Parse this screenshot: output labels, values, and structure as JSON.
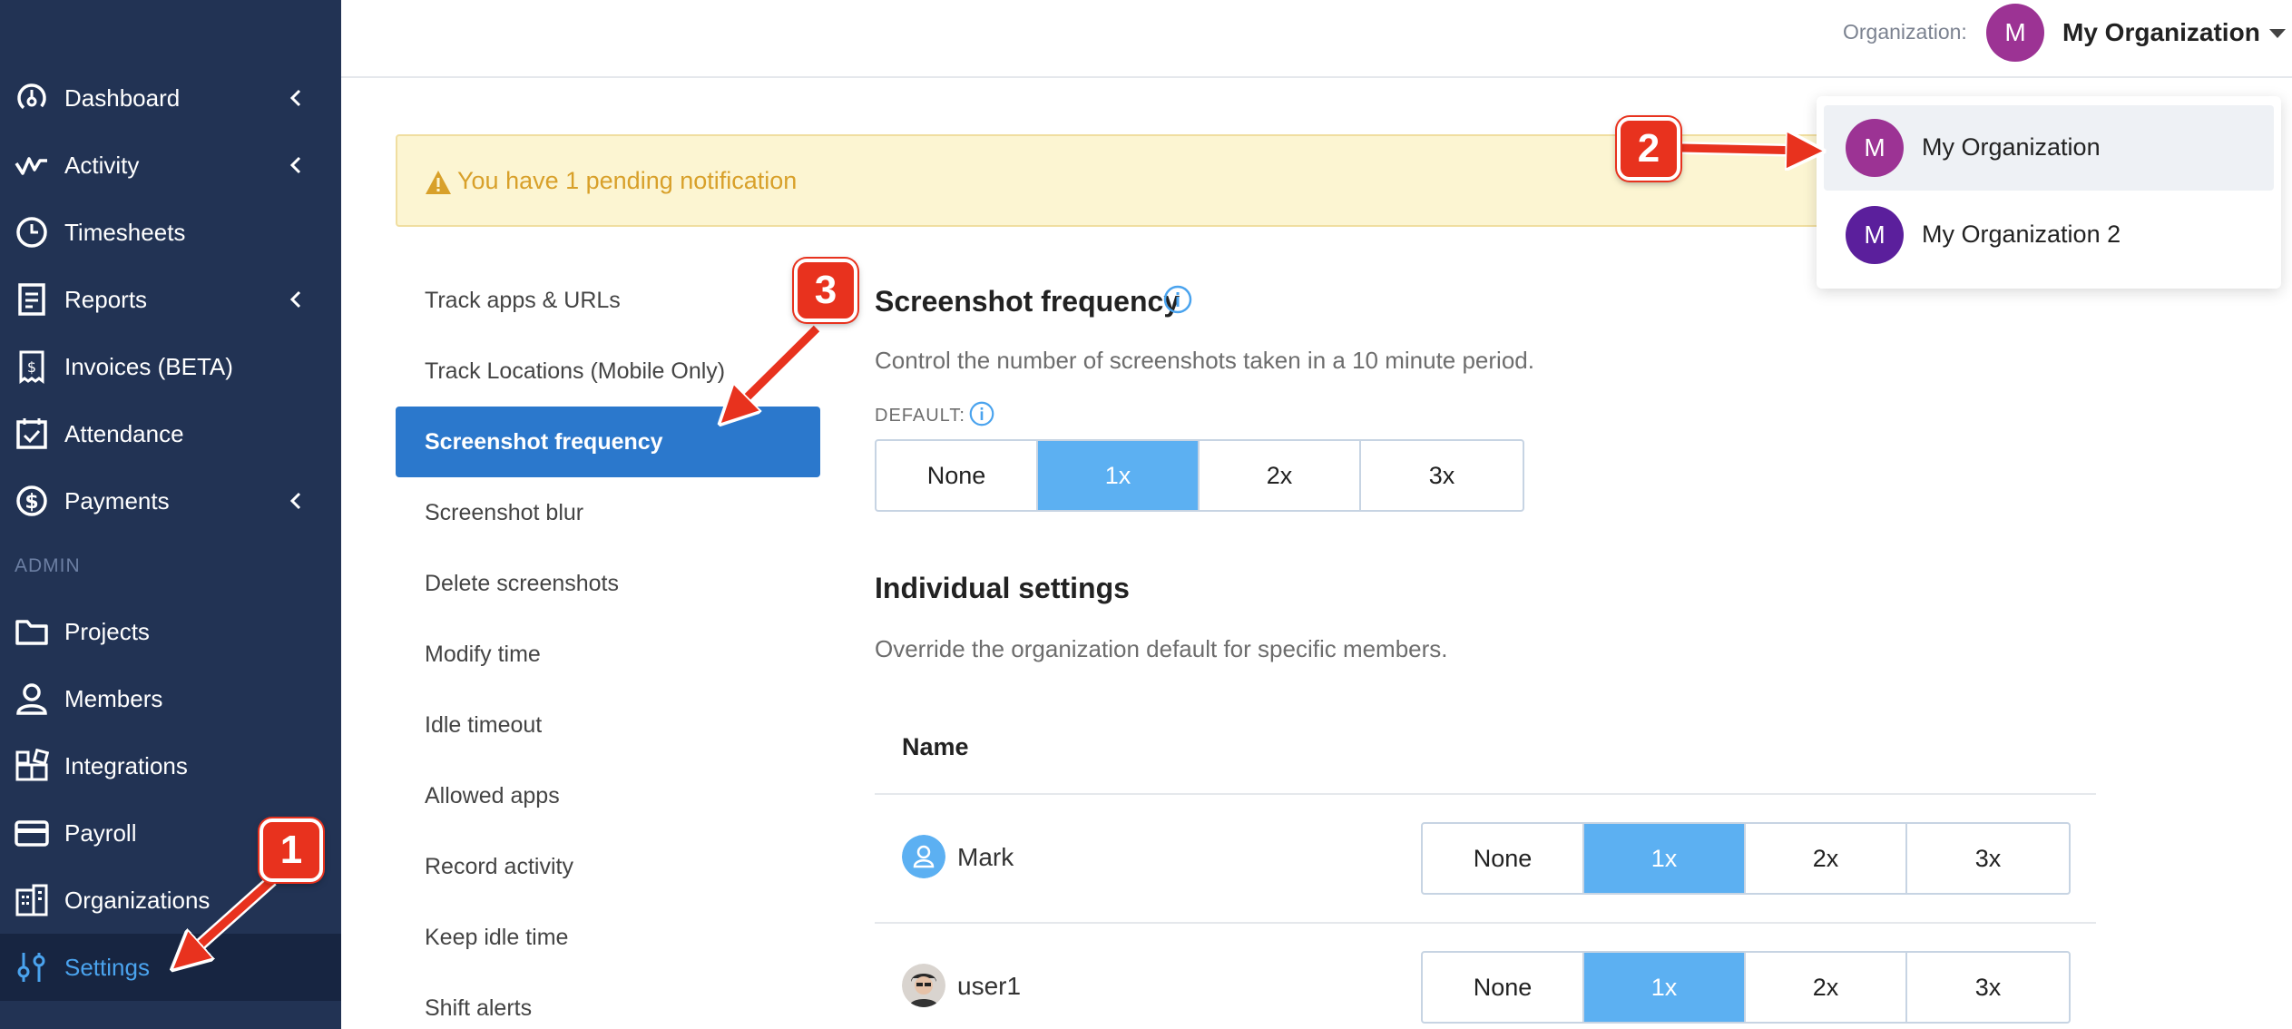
{
  "sidebar": {
    "items": [
      {
        "label": "Dashboard",
        "icon": "dashboard-gauge-icon",
        "expandable": true
      },
      {
        "label": "Activity",
        "icon": "activity-pulse-icon",
        "expandable": true
      },
      {
        "label": "Timesheets",
        "icon": "clock-icon",
        "expandable": false
      },
      {
        "label": "Reports",
        "icon": "report-document-icon",
        "expandable": true
      },
      {
        "label": "Invoices (BETA)",
        "icon": "invoice-receipt-icon",
        "expandable": false
      },
      {
        "label": "Attendance",
        "icon": "calendar-check-icon",
        "expandable": false
      },
      {
        "label": "Payments",
        "icon": "dollar-circle-icon",
        "expandable": true
      }
    ],
    "admin_label": "ADMIN",
    "admin_items": [
      {
        "label": "Projects",
        "icon": "folder-icon"
      },
      {
        "label": "Members",
        "icon": "person-icon"
      },
      {
        "label": "Integrations",
        "icon": "puzzle-blocks-icon"
      },
      {
        "label": "Payroll",
        "icon": "credit-card-icon"
      },
      {
        "label": "Organizations",
        "icon": "building-icon"
      },
      {
        "label": "Settings",
        "icon": "sliders-icon",
        "active": true
      }
    ]
  },
  "header": {
    "org_label": "Organization:",
    "org_initial": "M",
    "org_name": "My Organization"
  },
  "banner": {
    "text": "You have 1 pending notification"
  },
  "settings_nav": {
    "items": [
      {
        "label": "Track apps & URLs"
      },
      {
        "label": "Track Locations (Mobile Only)"
      },
      {
        "label": "Screenshot frequency",
        "active": true
      },
      {
        "label": "Screenshot blur"
      },
      {
        "label": "Delete screenshots"
      },
      {
        "label": "Modify time"
      },
      {
        "label": "Idle timeout"
      },
      {
        "label": "Allowed apps"
      },
      {
        "label": "Record activity"
      },
      {
        "label": "Keep idle time"
      },
      {
        "label": "Shift alerts"
      }
    ]
  },
  "content": {
    "title": "Screenshot frequency",
    "description": "Control the number of screenshots taken in a 10 minute period.",
    "default_label": "DEFAULT:",
    "options": [
      "None",
      "1x",
      "2x",
      "3x"
    ],
    "default_selected": "1x",
    "individual_title": "Individual settings",
    "individual_description": "Override the organization default for specific members.",
    "name_column": "Name",
    "members": [
      {
        "name": "Mark",
        "selected": "1x",
        "avatar": "default-user-avatar"
      },
      {
        "name": "user1",
        "selected": "1x",
        "avatar": "photo-avatar"
      }
    ]
  },
  "dropdown": {
    "items": [
      {
        "initial": "M",
        "name": "My Organization",
        "color": "#9c3394",
        "highlighted": true
      },
      {
        "initial": "M",
        "name": "My Organization 2",
        "color": "#5b1f9c",
        "highlighted": false
      }
    ]
  },
  "callouts": [
    "1",
    "2",
    "3"
  ],
  "colors": {
    "sidebar_bg": "#223354",
    "accent_blue": "#2b78cc",
    "selected_option": "#5cb0f2",
    "callout_red": "#e8321e"
  }
}
